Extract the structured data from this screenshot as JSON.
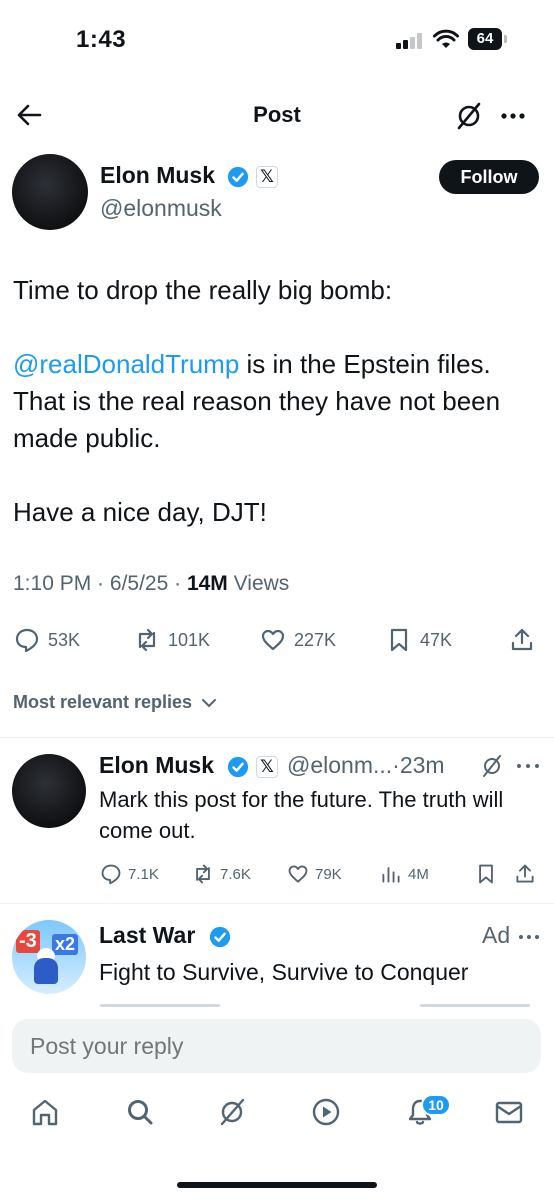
{
  "status_bar": {
    "time": "1:43",
    "battery": "64"
  },
  "header": {
    "title": "Post"
  },
  "post": {
    "author_name": "Elon Musk",
    "author_handle": "@elonmusk",
    "follow_label": "Follow",
    "text_line1": "Time to drop the really big bomb:",
    "mention": "@realDonaldTrump",
    "text_mention_rest": " is in the Epstein files.",
    "text_line3": "That is the real reason they have not been made public.",
    "text_line4": "Have a nice day, DJT!",
    "time": "1:10 PM",
    "date": "6/5/25",
    "views_count": "14M",
    "views_label": "Views",
    "stats": {
      "replies": "53K",
      "reposts": "101K",
      "likes": "227K",
      "bookmarks": "47K"
    }
  },
  "sort": {
    "label": "Most relevant replies"
  },
  "reply": {
    "author_name": "Elon Musk",
    "author_handle": "@elonm...",
    "time": "·23m",
    "text": "Mark this post for the future. The truth will come out.",
    "stats": {
      "replies": "7.1K",
      "reposts": "7.6K",
      "likes": "79K",
      "views": "4M"
    }
  },
  "ad": {
    "name": "Last War",
    "tag": "Ad",
    "text": "Fight to Survive, Survive to Conquer",
    "avatar_badge_a": "-3",
    "avatar_badge_b": "x2"
  },
  "composer": {
    "placeholder": "Post your reply"
  },
  "nav": {
    "notifications_badge": "10"
  },
  "colors": {
    "accent": "#1d9bf0",
    "text": "#0f1419",
    "muted": "#536471",
    "divider": "#eff3f4"
  },
  "icons": [
    "back-arrow-icon",
    "grok-icon",
    "more-icon",
    "verified-icon",
    "x-logo-icon",
    "reply-icon",
    "repost-icon",
    "like-icon",
    "bookmark-icon",
    "share-icon",
    "views-icon",
    "home-icon",
    "search-icon",
    "video-icon",
    "bell-icon",
    "mail-icon"
  ]
}
